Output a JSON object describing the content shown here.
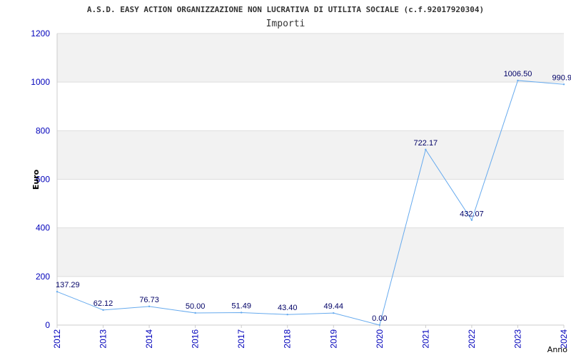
{
  "chart_data": {
    "type": "line",
    "title": "A.S.D. EASY ACTION ORGANIZZAZIONE NON LUCRATIVA DI UTILITA SOCIALE (c.f.92017920304)",
    "subtitle": "Importi",
    "xlabel": "Anno",
    "ylabel": "Euro",
    "ylim": [
      0,
      1200
    ],
    "yticks": [
      0,
      200,
      400,
      600,
      800,
      1000,
      1200
    ],
    "categories": [
      "2012",
      "2013",
      "2014",
      "2016",
      "2017",
      "2018",
      "2019",
      "2020",
      "2021",
      "2022",
      "2023",
      "2024"
    ],
    "series": [
      {
        "values": [
          137.29,
          62.12,
          76.73,
          50.0,
          51.49,
          43.4,
          49.44,
          0.0,
          722.17,
          432.07,
          1006.5,
          990.9
        ],
        "labels": [
          "137.29",
          "62.12",
          "76.73",
          "50.00",
          "51.49",
          "43.40",
          "49.44",
          "0.00",
          "722.17",
          "432.07",
          "1006.50",
          "990.9"
        ]
      }
    ],
    "grid": true,
    "band_colors": [
      "#f2f2f2",
      "#ffffff"
    ],
    "line_color": "#66aaee",
    "tick_color": "#0000bb"
  }
}
